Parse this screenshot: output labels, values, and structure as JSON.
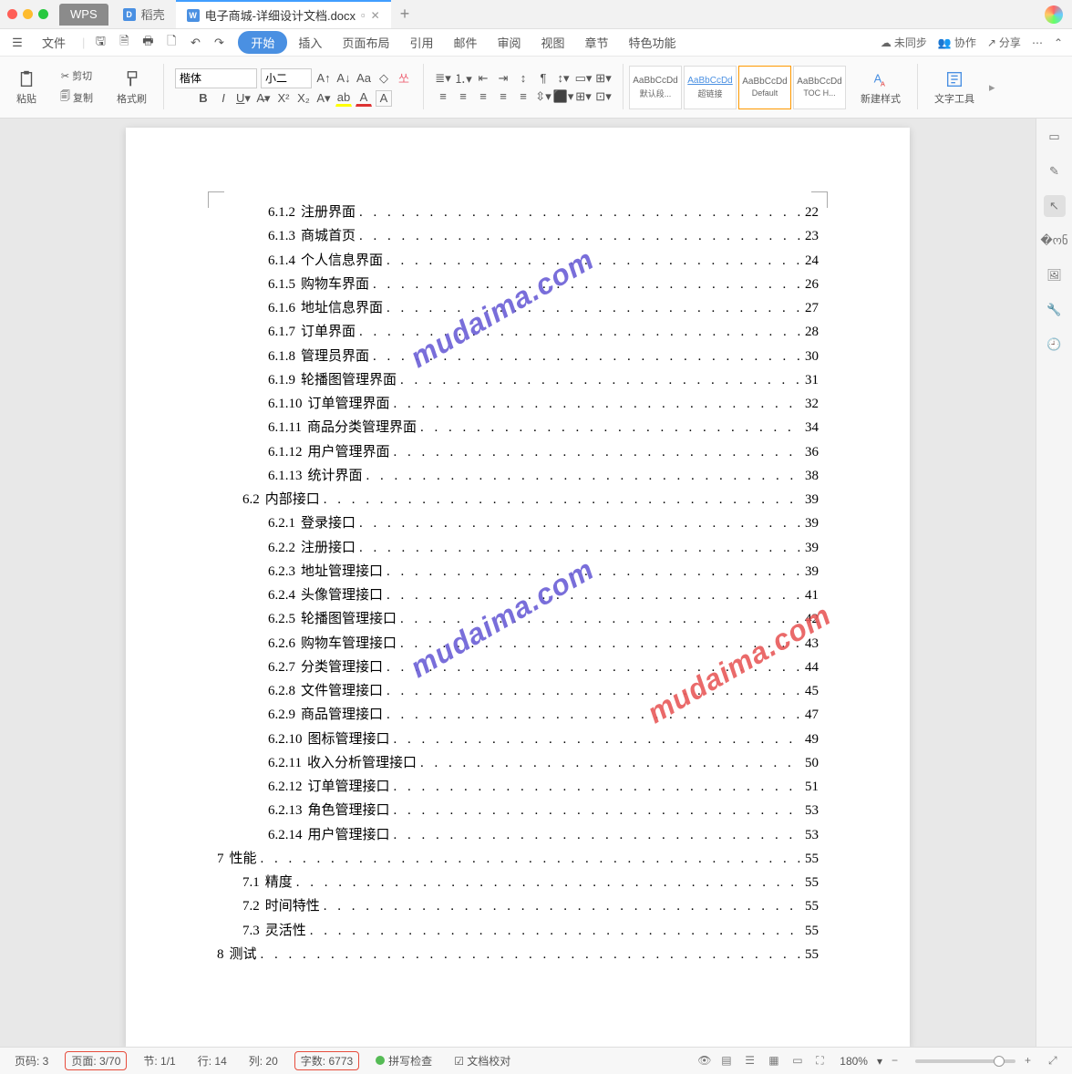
{
  "titlebar": {
    "app_tab": "WPS",
    "tab2": "稻壳",
    "active_tab": "电子商城-详细设计文档.docx"
  },
  "menubar": {
    "file": "文件",
    "items": [
      "开始",
      "插入",
      "页面布局",
      "引用",
      "邮件",
      "审阅",
      "视图",
      "章节",
      "特色功能"
    ],
    "right": {
      "sync": "未同步",
      "collab": "协作",
      "share": "分享"
    }
  },
  "ribbon": {
    "paste": "粘贴",
    "cut": "剪切",
    "copy": "复制",
    "format_painter": "格式刷",
    "font_name": "楷体",
    "font_size": "小二",
    "styles": {
      "s1": {
        "preview": "AaBbCcDd",
        "name": "默认段..."
      },
      "s2": {
        "preview": "AaBbCcDd",
        "name": "超链接"
      },
      "s3": {
        "preview": "AaBbCcDd",
        "name": "Default"
      },
      "s4": {
        "preview": "AaBbCcDd",
        "name": "TOC H..."
      }
    },
    "new_style": "新建样式",
    "text_tools": "文字工具"
  },
  "toc": [
    {
      "lvl": 3,
      "num": "6.1.2",
      "title": "注册界面",
      "page": "22"
    },
    {
      "lvl": 3,
      "num": "6.1.3",
      "title": "商城首页",
      "page": "23"
    },
    {
      "lvl": 3,
      "num": "6.1.4",
      "title": "个人信息界面",
      "page": "24"
    },
    {
      "lvl": 3,
      "num": "6.1.5",
      "title": "购物车界面",
      "page": "26"
    },
    {
      "lvl": 3,
      "num": "6.1.6",
      "title": "地址信息界面",
      "page": "27"
    },
    {
      "lvl": 3,
      "num": "6.1.7",
      "title": "订单界面",
      "page": "28"
    },
    {
      "lvl": 3,
      "num": "6.1.8",
      "title": "管理员界面",
      "page": "30"
    },
    {
      "lvl": 3,
      "num": "6.1.9",
      "title": "轮播图管理界面",
      "page": "31"
    },
    {
      "lvl": 3,
      "num": "6.1.10",
      "title": "订单管理界面",
      "page": "32"
    },
    {
      "lvl": 3,
      "num": "6.1.11",
      "title": "商品分类管理界面",
      "page": "34"
    },
    {
      "lvl": 3,
      "num": "6.1.12",
      "title": "用户管理界面",
      "page": "36"
    },
    {
      "lvl": 3,
      "num": "6.1.13",
      "title": "统计界面",
      "page": "38"
    },
    {
      "lvl": 2,
      "num": "6.2",
      "title": "内部接口",
      "page": "39"
    },
    {
      "lvl": 3,
      "num": "6.2.1",
      "title": "登录接口",
      "page": "39"
    },
    {
      "lvl": 3,
      "num": "6.2.2",
      "title": "注册接口",
      "page": "39"
    },
    {
      "lvl": 3,
      "num": "6.2.3",
      "title": "地址管理接口",
      "page": "39"
    },
    {
      "lvl": 3,
      "num": "6.2.4",
      "title": "头像管理接口",
      "page": "41"
    },
    {
      "lvl": 3,
      "num": "6.2.5",
      "title": "轮播图管理接口",
      "page": "42"
    },
    {
      "lvl": 3,
      "num": "6.2.6",
      "title": "购物车管理接口",
      "page": "43"
    },
    {
      "lvl": 3,
      "num": "6.2.7",
      "title": "分类管理接口",
      "page": "44"
    },
    {
      "lvl": 3,
      "num": "6.2.8",
      "title": "文件管理接口",
      "page": "45"
    },
    {
      "lvl": 3,
      "num": "6.2.9",
      "title": "商品管理接口",
      "page": "47"
    },
    {
      "lvl": 3,
      "num": "6.2.10",
      "title": "图标管理接口",
      "page": "49"
    },
    {
      "lvl": 3,
      "num": "6.2.11",
      "title": "收入分析管理接口",
      "page": "50"
    },
    {
      "lvl": 3,
      "num": "6.2.12",
      "title": "订单管理接口",
      "page": "51"
    },
    {
      "lvl": 3,
      "num": "6.2.13",
      "title": "角色管理接口",
      "page": "53"
    },
    {
      "lvl": 3,
      "num": "6.2.14",
      "title": "用户管理接口",
      "page": "53"
    },
    {
      "lvl": 1,
      "num": "7",
      "title": "性能",
      "page": "55"
    },
    {
      "lvl": 2,
      "num": "7.1",
      "title": "精度",
      "page": "55"
    },
    {
      "lvl": 2,
      "num": "7.2",
      "title": "时间特性",
      "page": "55"
    },
    {
      "lvl": 2,
      "num": "7.3",
      "title": "灵活性",
      "page": "55"
    },
    {
      "lvl": 1,
      "num": "8",
      "title": "测试",
      "page": "55"
    }
  ],
  "watermark": "mudaima.com",
  "status": {
    "page_code": "页码: 3",
    "page": "页面: 3/70",
    "section": "节: 1/1",
    "row": "行: 14",
    "col": "列: 20",
    "words": "字数: 6773",
    "spellcheck": "拼写检查",
    "proof": "文档校对",
    "zoom": "180%"
  }
}
